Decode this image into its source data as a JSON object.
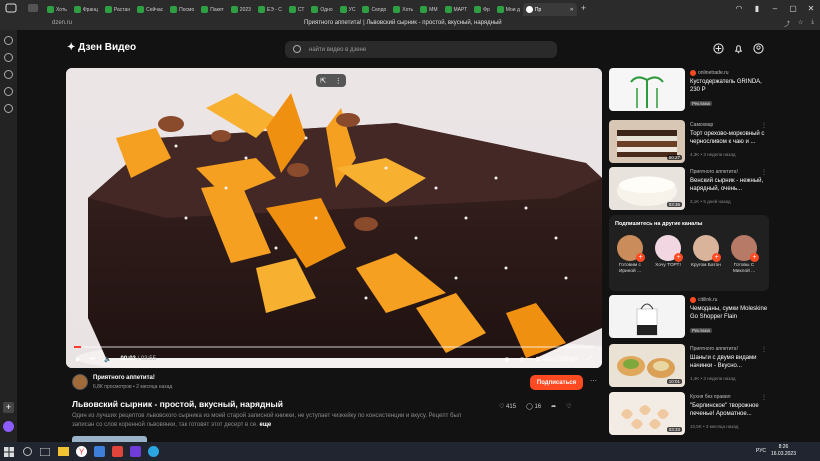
{
  "browser": {
    "tabs": [
      {
        "label": "Хоть"
      },
      {
        "label": "Франц"
      },
      {
        "label": "Растан"
      },
      {
        "label": "Сейчас"
      },
      {
        "label": "Посмо"
      },
      {
        "label": "Пакет"
      },
      {
        "label": "2023"
      },
      {
        "label": "ЕЭ - С"
      },
      {
        "label": "СТ"
      },
      {
        "label": "Одно"
      },
      {
        "label": "УС"
      },
      {
        "label": "Селдо"
      },
      {
        "label": "Хоть"
      },
      {
        "label": "ММ"
      },
      {
        "label": "МАРТ"
      },
      {
        "label": "Фр"
      },
      {
        "label": "Мои д"
      }
    ],
    "active_tab": "Пр",
    "url": "dzen.ru",
    "page_title": "Приятного аппетита! | Львовский сырник - простой, вкусный, нарядный"
  },
  "header": {
    "logo": "Дзен Видео",
    "search_placeholder": "найти видео в дзене"
  },
  "player": {
    "time_current": "00:03",
    "time_total": "03:55",
    "quality": "Авто (1080p)",
    "progress_fraction": 0.013
  },
  "channel": {
    "name": "Приятного аппетита!",
    "meta": "6,8К просмотров • 2 месяца назад",
    "subscribe_label": "Подписаться"
  },
  "video": {
    "title": "Львовский сырник - простой, вкусный, нарядный",
    "description": "Один из лучших рецептов львовского сырника из моей старой записной книжки, не уступает чизкейку по консистенции и вкусу. Рецепт был записан со слов коренной львовянки, так готовят этот десерт в се.",
    "more_label": "еще",
    "likes": "415",
    "comments": "16"
  },
  "sidebar": {
    "cards": [
      {
        "source": "onlinetrade.ru",
        "title": "Кустодержатель GRINDA, 230 Р",
        "badge": "Реклама",
        "duration": ""
      },
      {
        "source": "Самохвар",
        "title": "Торт орехово-морковный с черносливом к чаю и ...",
        "meta": "4,3K • 3 недели назад",
        "duration": "00:27"
      },
      {
        "source": "Приятного аппетита!",
        "title": "Венский сырник - нежный, нарядный, очень...",
        "meta": "3,1K • 5 дней назад",
        "duration": "03:36"
      }
    ],
    "recommend_title": "Подпишитесь на другие каналы",
    "channels": [
      {
        "name": "Готовим с Ириной ..."
      },
      {
        "name": "Хочу ТОРТ!"
      },
      {
        "name": "Кругом Батон"
      },
      {
        "name": "Готовы С Миклой ..."
      }
    ],
    "cards2": [
      {
        "source": "citilink.ru",
        "title": "Чемоданы, сумки Moleskine Go Shopper Flain",
        "badge": "Реклама",
        "duration": ""
      },
      {
        "source": "Приятного аппетита!",
        "title": "Шаньги с двумя видами начинки - Вкусно...",
        "meta": "1,4K • 3 недели назад",
        "duration": "10:01"
      },
      {
        "source": "Кухня без правил",
        "title": "\"Берлинское\" творожное печенье! Ароматное...",
        "meta": "10,5K • 3 месяца назад",
        "duration": "03:33"
      }
    ]
  },
  "taskbar": {
    "lang": "РУС",
    "time": "8:26",
    "date": "16.03.2023"
  }
}
